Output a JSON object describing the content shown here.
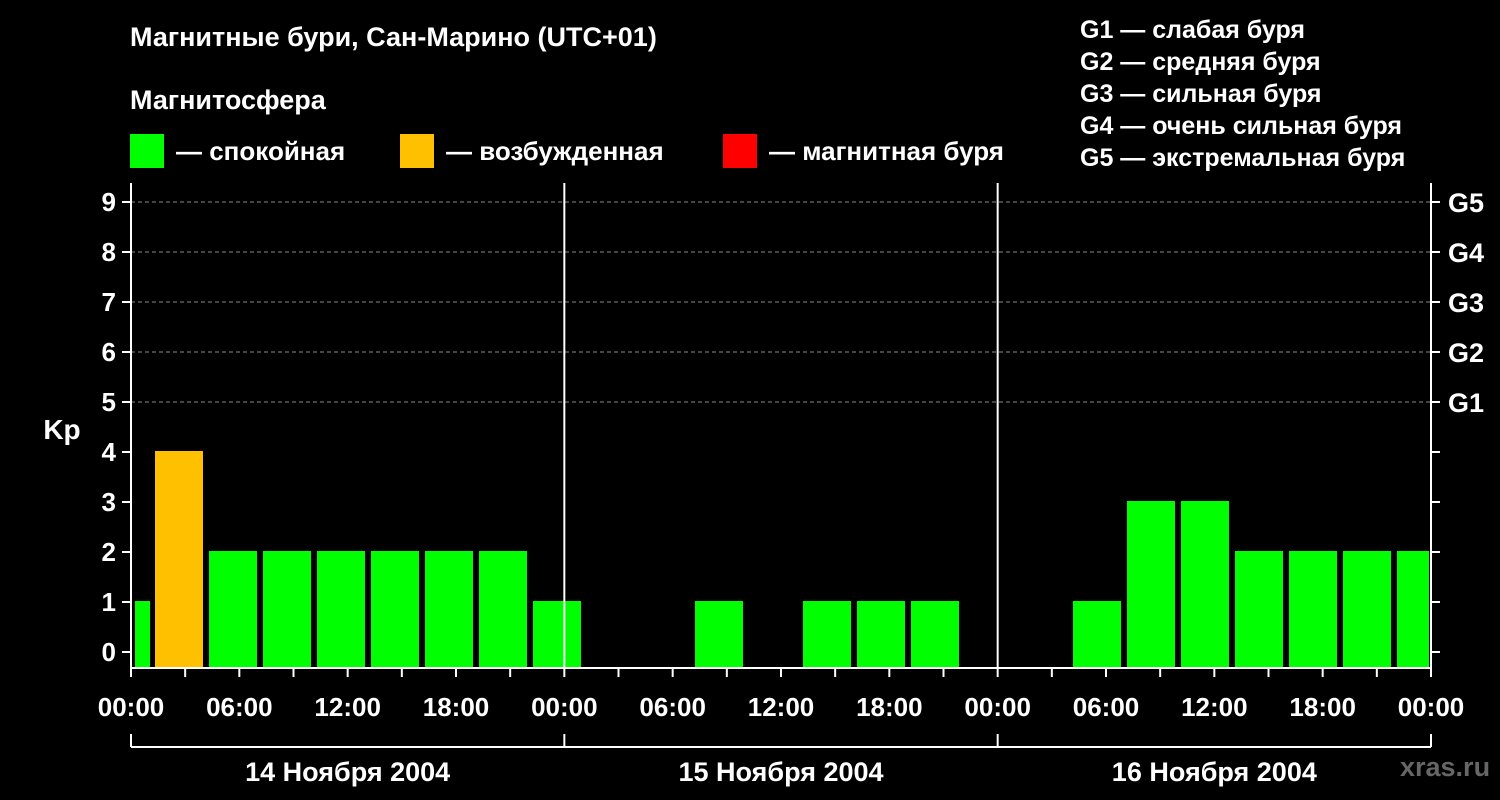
{
  "title": "Магнитные бури, Сан-Марино (UTC+01)",
  "subtitle": "Магнитосфера",
  "legend": [
    {
      "label": "— спокойная",
      "color": "#00ff00"
    },
    {
      "label": "— возбужденная",
      "color": "#ffc000"
    },
    {
      "label": "— магнитная буря",
      "color": "#ff0000"
    }
  ],
  "g_legend": [
    "G1 — слабая буря",
    "G2 — средняя буря",
    "G3 — сильная буря",
    "G4 — очень сильная буря",
    "G5 — экстремальная буря"
  ],
  "watermark": "xras.ru",
  "chart_data": {
    "type": "bar",
    "ylabel": "Kp",
    "ylim": [
      0,
      9
    ],
    "yticks": [
      "0",
      "1",
      "2",
      "3",
      "4",
      "5",
      "6",
      "7",
      "8",
      "9"
    ],
    "right_labels": [
      {
        "level": 5,
        "label": "G1"
      },
      {
        "level": 6,
        "label": "G2"
      },
      {
        "level": 7,
        "label": "G3"
      },
      {
        "level": 8,
        "label": "G4"
      },
      {
        "level": 9,
        "label": "G5"
      }
    ],
    "xtick_labels": [
      "00:00",
      "06:00",
      "12:00",
      "18:00",
      "00:00",
      "06:00",
      "12:00",
      "18:00",
      "00:00",
      "06:00",
      "12:00",
      "18:00",
      "00:00"
    ],
    "days": [
      "14 Ноября 2004",
      "15 Ноября 2004",
      "16 Ноября 2004"
    ],
    "grid": true,
    "colors": {
      "quiet": "#00ff00",
      "active": "#ffc000",
      "storm": "#ff0000"
    },
    "values": [
      1,
      4,
      2,
      2,
      2,
      2,
      2,
      2,
      1,
      0,
      0,
      1,
      0,
      1,
      1,
      1,
      0,
      0,
      1,
      3,
      3,
      2,
      2,
      2,
      2
    ],
    "bar_colors": [
      "quiet",
      "active",
      "quiet",
      "quiet",
      "quiet",
      "quiet",
      "quiet",
      "quiet",
      "quiet",
      "quiet",
      "quiet",
      "quiet",
      "quiet",
      "quiet",
      "quiet",
      "quiet",
      "quiet",
      "quiet",
      "quiet",
      "quiet",
      "quiet",
      "quiet",
      "quiet",
      "quiet",
      "quiet"
    ]
  }
}
